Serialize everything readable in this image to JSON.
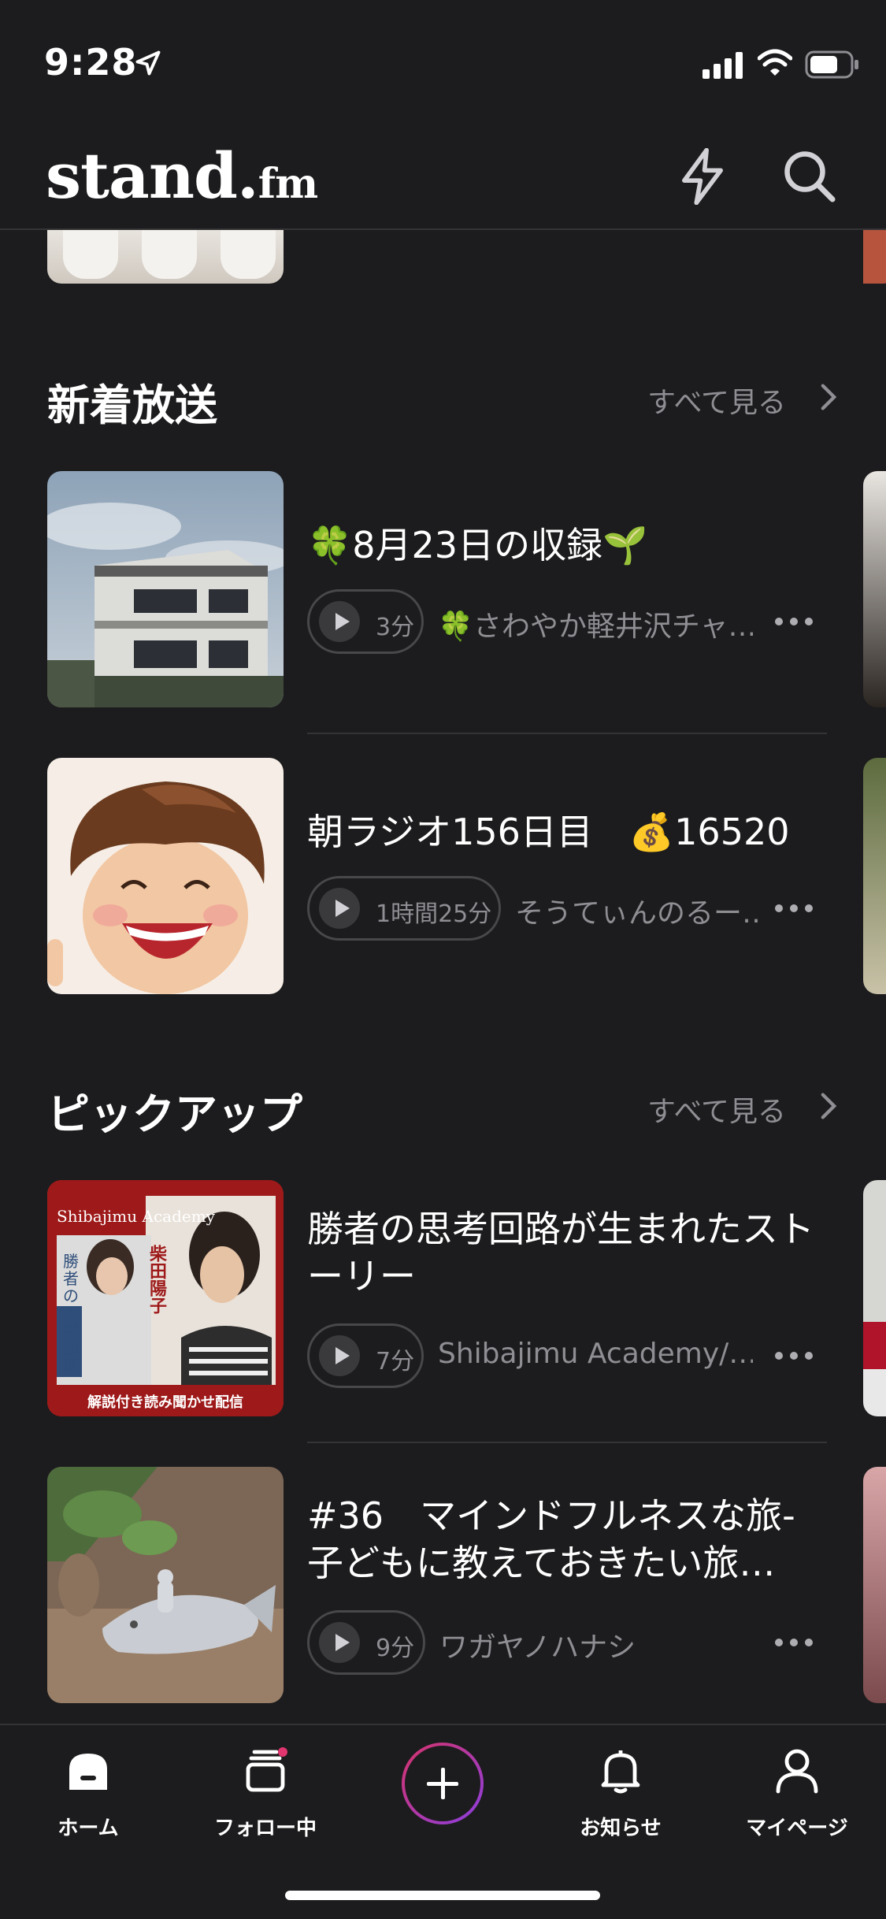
{
  "status_bar": {
    "time": "9:28"
  },
  "header": {
    "logo_main": "stand.",
    "logo_suffix": "fm"
  },
  "sections": [
    {
      "title": "新着放送",
      "see_all": "すべて見る"
    },
    {
      "title": "ピックアップ",
      "see_all": "すべて見る"
    }
  ],
  "episodes": [
    {
      "title": "🍀8月23日の収録🌱",
      "duration": "3分",
      "channel": "🍀さわやか軽井沢チャ…"
    },
    {
      "title": "朝ラジオ156日目　💰16520",
      "duration": "1時間25分",
      "channel": "そうてぃんのるー…"
    },
    {
      "title": "勝者の思考回路が生まれたストーリー",
      "duration": "7分",
      "channel": "Shibajimu Academy/…"
    },
    {
      "title": "#36　マインドフルネスな旅-子どもに教えておきたい旅…",
      "duration": "9分",
      "channel": "ワガヤノハナシ"
    }
  ],
  "thumb_texts": {
    "shibajimu_top": "Shibajimu Academy",
    "shibajimu_bottom": "解説付き読み聞かせ配信",
    "book_title": "勝者の思考回路",
    "author": "柴田陽子"
  },
  "tabbar": [
    {
      "label": "ホーム",
      "icon": "home-icon"
    },
    {
      "label": "フォロー中",
      "icon": "following-icon"
    },
    {
      "label": "",
      "icon": "plus-icon"
    },
    {
      "label": "お知らせ",
      "icon": "bell-icon"
    },
    {
      "label": "マイページ",
      "icon": "person-icon"
    }
  ],
  "colors": {
    "background": "#1c1c1e",
    "accent_start": "#d7336b",
    "accent_end": "#8b3ee0",
    "muted": "#8e8e93"
  }
}
